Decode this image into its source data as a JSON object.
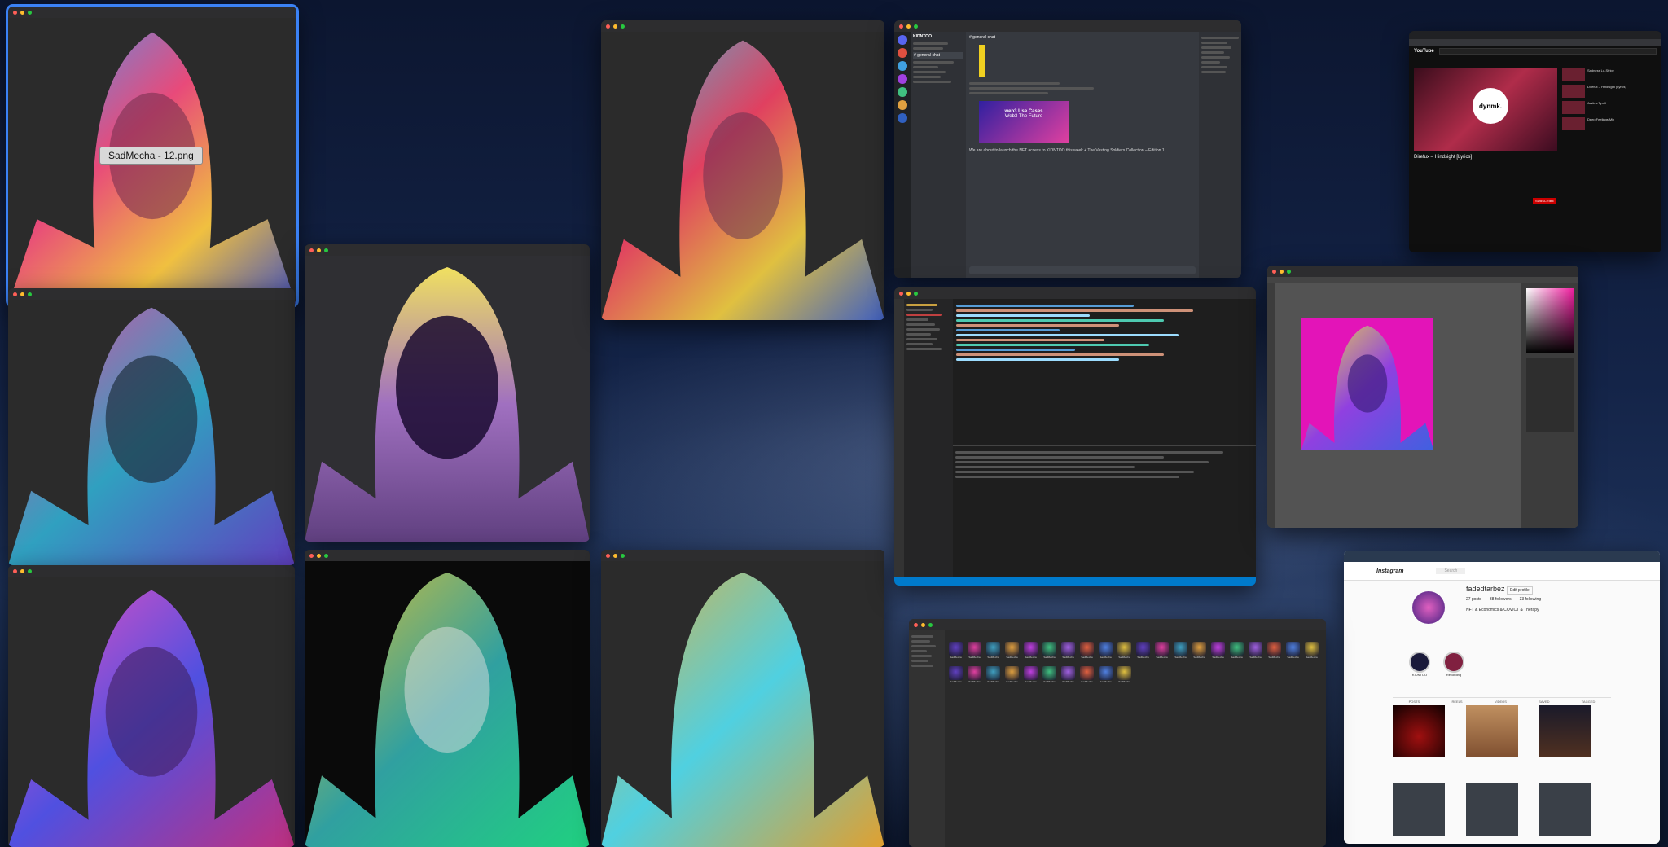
{
  "tooltip": "SadMecha - 12.png",
  "discord": {
    "server_name": "KIDNTOO",
    "channel": "# general-chat",
    "embed_title": "web3 Use Cases",
    "embed_sub": "Web3 The Future",
    "message": "We are about to launch the NFT access to KIDNTOO this week + The Vesting Soldiers Collection – Edition 1"
  },
  "youtube": {
    "logo": "YouTube",
    "channel_mark": "dynmk.",
    "title": "Direfux – Hindsight [Lyrics]",
    "subscribe": "SUBSCRIBE",
    "side_items": [
      "Sadness Lo-Stripe",
      "Direfux – Hindsight (Lyrics)",
      "Justins Tyroll",
      "Deep Feelings Mix"
    ]
  },
  "instagram": {
    "logo": "Instagram",
    "search": "Search",
    "username": "fadedtarbez",
    "edit_profile": "Edit profile",
    "posts": "27 posts",
    "followers": "38 followers",
    "following": "33 following",
    "bio": "NFT & Economics & COVICT & Therapy",
    "highlights": [
      "KIDNTOO",
      "Recording"
    ],
    "tabs": [
      "POSTS",
      "REELS",
      "VIDEOS",
      "SAVED",
      "TAGGED"
    ]
  },
  "finder": {
    "item_label": "SadMecha"
  },
  "colors": {
    "selection": "#3b82f6",
    "ps_bg": "#e314b8"
  }
}
